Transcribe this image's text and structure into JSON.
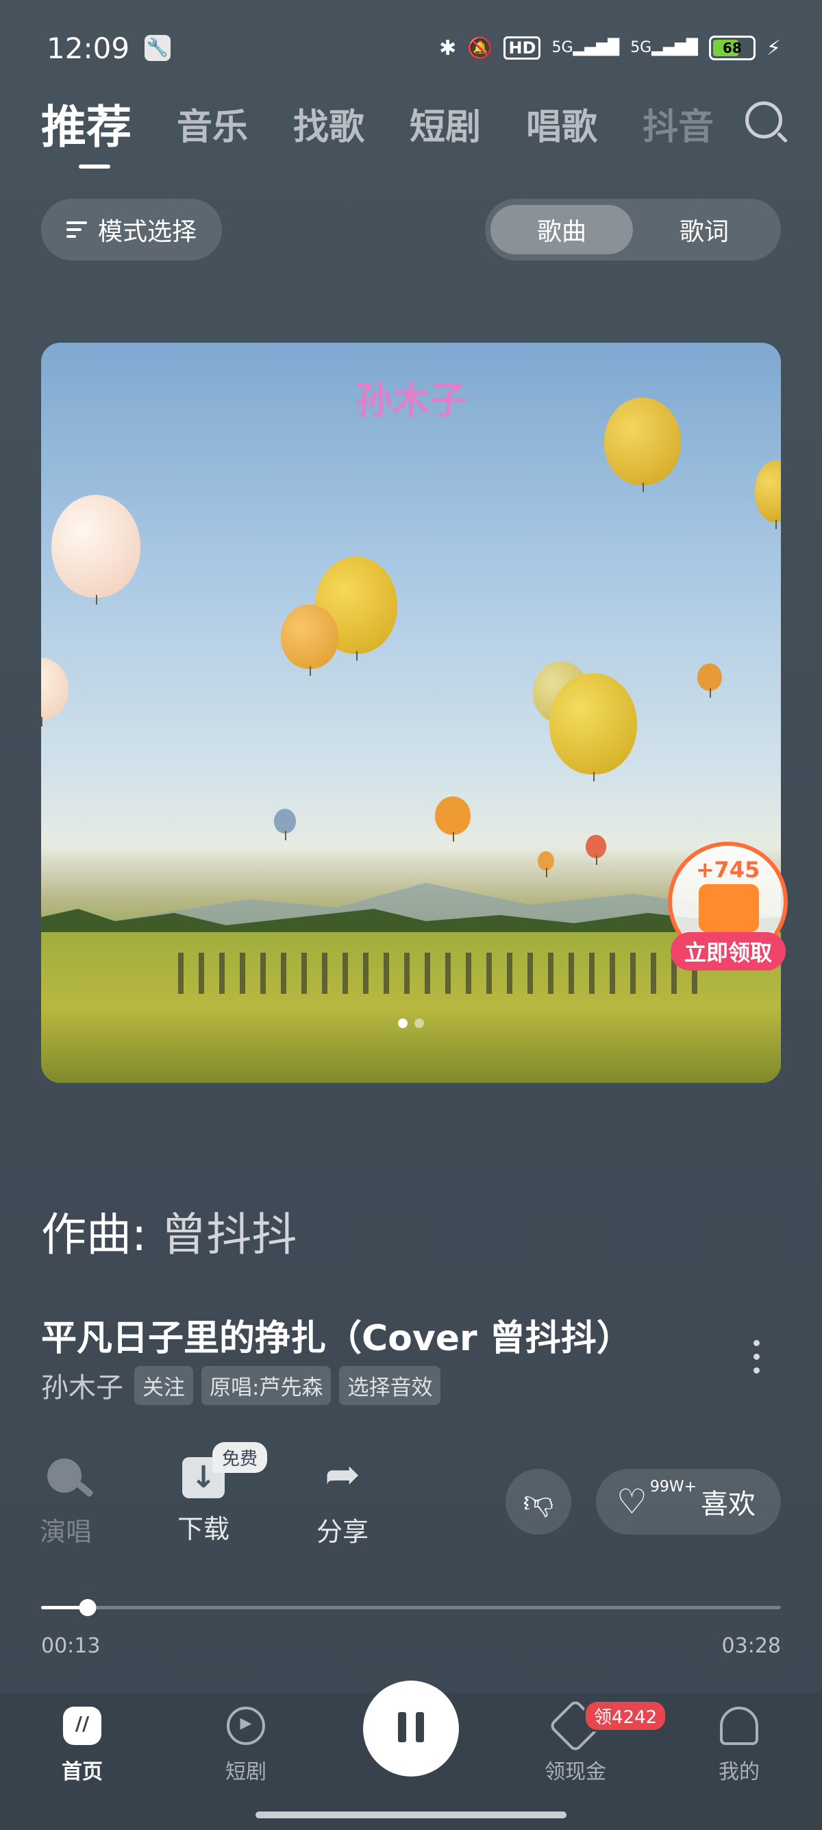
{
  "status_bar": {
    "time": "12:09",
    "hd": "HD",
    "signal1": "5G",
    "signal2": "5G",
    "battery": "68"
  },
  "tabs": [
    "推荐",
    "音乐",
    "找歌",
    "短剧",
    "唱歌",
    "抖音"
  ],
  "mode_select": "模式选择",
  "segment": {
    "song": "歌曲",
    "lyrics": "歌词"
  },
  "cover": {
    "artist_mark": "孙木子"
  },
  "reward": {
    "amount": "+745",
    "claim": "立即领取"
  },
  "composer": {
    "label": "作曲:",
    "name": "曾抖抖"
  },
  "song": {
    "title": "平凡日子里的挣扎（Cover 曾抖抖）",
    "artist": "孙木子",
    "follow": "关注",
    "original": "原唱:芦先森",
    "effect": "选择音效"
  },
  "actions": {
    "sing": "演唱",
    "download": "下载",
    "free_badge": "免费",
    "share": "分享",
    "like_count": "99W+",
    "like": "喜欢"
  },
  "progress": {
    "current": "00:13",
    "total": "03:28",
    "fraction": 0.0625
  },
  "bottom_nav": {
    "home": "首页",
    "drama": "短剧",
    "cash": "领现金",
    "cash_badge": "领4242",
    "mine": "我的"
  },
  "colors": {
    "reward_accent": "#ff6d3a",
    "claim_pink": "#f0446a",
    "badge_red": "#e8464f"
  }
}
